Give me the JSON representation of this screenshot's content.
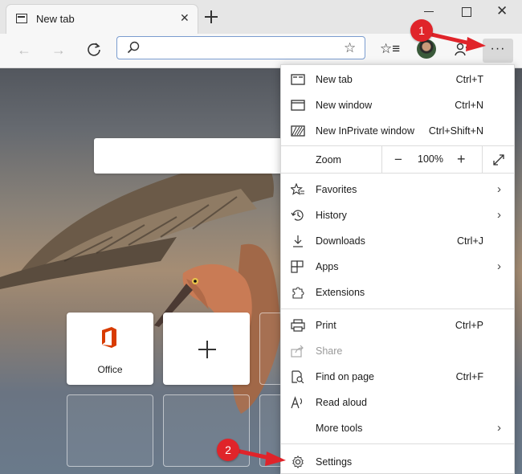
{
  "browser": {
    "tab_title": "New tab",
    "address_placeholder": ""
  },
  "ntp": {
    "tiles": [
      {
        "label": "Office"
      },
      {
        "label": ""
      }
    ]
  },
  "menu": {
    "items_top": [
      {
        "label": "New tab",
        "shortcut": "Ctrl+T",
        "icon": "new-tab-icon"
      },
      {
        "label": "New window",
        "shortcut": "Ctrl+N",
        "icon": "window-icon"
      },
      {
        "label": "New InPrivate window",
        "shortcut": "Ctrl+Shift+N",
        "icon": "inprivate-icon"
      }
    ],
    "zoom": {
      "label": "Zoom",
      "value": "100%",
      "minus": "−",
      "plus": "+"
    },
    "items_mid": [
      {
        "label": "Favorites",
        "icon": "favorites-icon"
      },
      {
        "label": "History",
        "icon": "history-icon"
      },
      {
        "label": "Downloads",
        "shortcut": "Ctrl+J",
        "icon": "download-icon"
      },
      {
        "label": "Apps",
        "icon": "apps-icon"
      },
      {
        "label": "Extensions",
        "icon": "extensions-icon"
      }
    ],
    "items_low": [
      {
        "label": "Print",
        "shortcut": "Ctrl+P",
        "icon": "print-icon"
      },
      {
        "label": "Share",
        "icon": "share-icon",
        "disabled": true
      },
      {
        "label": "Find on page",
        "shortcut": "Ctrl+F",
        "icon": "find-icon"
      },
      {
        "label": "Read aloud",
        "icon": "read-aloud-icon"
      },
      {
        "label": "More tools",
        "icon": "tools-icon"
      }
    ],
    "settings": {
      "label": "Settings",
      "icon": "gear-icon"
    }
  },
  "annotations": {
    "badge1": "1",
    "badge2": "2"
  },
  "colors": {
    "accent_badge": "#e0242a",
    "office_red": "#d83b01"
  }
}
